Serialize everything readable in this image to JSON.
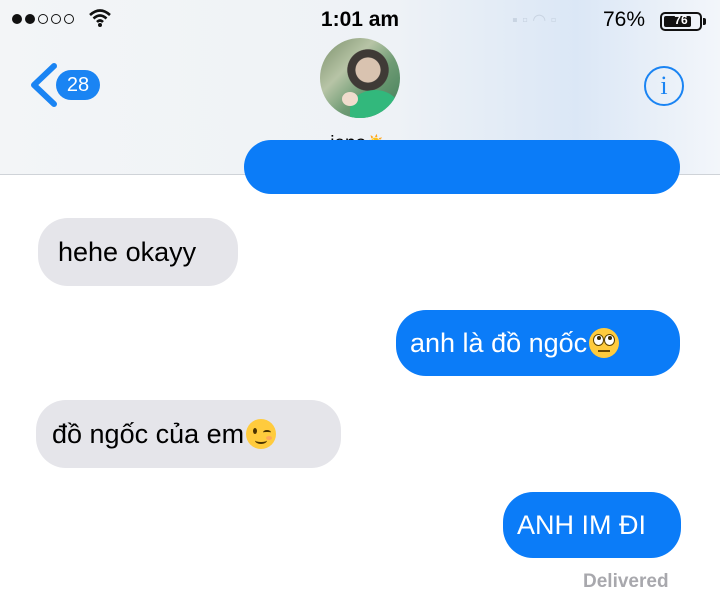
{
  "status_bar": {
    "time": "1:01 am",
    "battery_percent_text": "76%",
    "battery_icon_text": "76"
  },
  "header": {
    "back_count": "28",
    "contact_name": "jeno",
    "contact_emoji": "⛅"
  },
  "messages": [
    {
      "direction": "outgoing",
      "text": "",
      "partial": true
    },
    {
      "direction": "incoming",
      "text": "hehe okayy"
    },
    {
      "direction": "outgoing",
      "text": "anh là đồ ngốc",
      "emoji": "face-with-rolling-eyes"
    },
    {
      "direction": "incoming",
      "text": "đồ ngốc của em",
      "emoji": "winking-face"
    },
    {
      "direction": "outgoing",
      "text": "ANH IM ĐI"
    }
  ],
  "delivery_status": "Delivered",
  "colors": {
    "outgoing_bubble": "#0b7cf8",
    "incoming_bubble": "#e5e5ea",
    "accent": "#1a84f3"
  }
}
